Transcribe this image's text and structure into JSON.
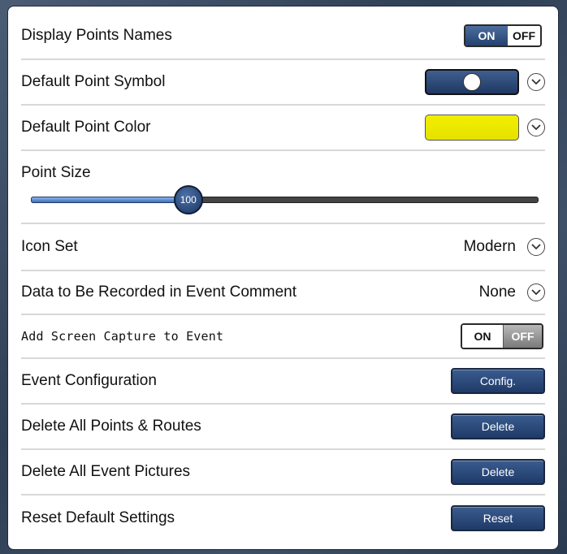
{
  "settings": {
    "display_points_names": {
      "label": "Display Points Names",
      "on": "ON",
      "off": "OFF",
      "state": "on"
    },
    "default_point_symbol": {
      "label": "Default Point Symbol"
    },
    "default_point_color": {
      "label": "Default Point Color",
      "color": "#f2ee00"
    },
    "point_size": {
      "label": "Point Size",
      "value": "100",
      "fraction": 0.31
    },
    "icon_set": {
      "label": "Icon Set",
      "value": "Modern"
    },
    "event_comment": {
      "label": "Data to Be Recorded in Event Comment",
      "value": "None"
    },
    "screen_capture": {
      "label": "Add Screen Capture to Event",
      "on": "ON",
      "off": "OFF",
      "state": "off"
    },
    "event_configuration": {
      "label": "Event Configuration",
      "button": "Config."
    },
    "delete_points_routes": {
      "label": "Delete All Points & Routes",
      "button": "Delete"
    },
    "delete_event_pictures": {
      "label": "Delete All Event Pictures",
      "button": "Delete"
    },
    "reset_defaults": {
      "label": "Reset Default Settings",
      "button": "Reset"
    }
  },
  "colors": {
    "accent": "#1f3a68",
    "slider_fill": "#5b8fd6"
  }
}
